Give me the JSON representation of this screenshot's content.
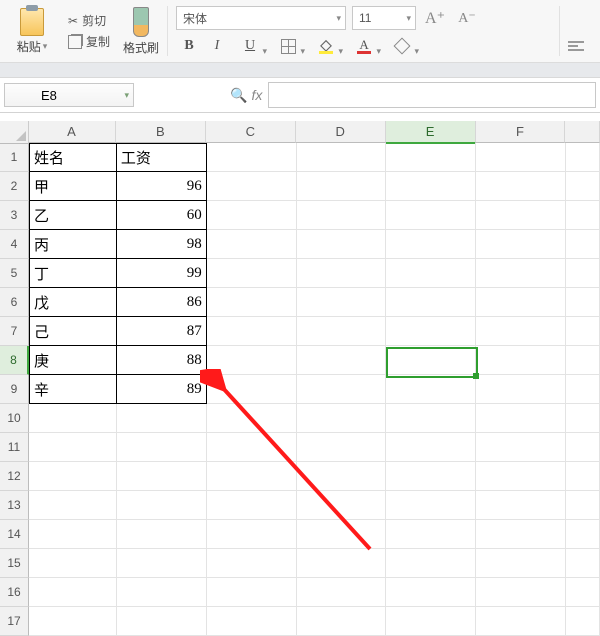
{
  "ribbon": {
    "paste_label": "粘贴",
    "cut_label": "剪切",
    "copy_label": "复制",
    "format_painter_label": "格式刷",
    "font_name": "宋体",
    "font_size": "11",
    "bold": "B",
    "italic": "I",
    "underline": "U"
  },
  "namebox": {
    "value": "E8",
    "fx_label": "fx"
  },
  "columns": [
    "A",
    "B",
    "C",
    "D",
    "E",
    "F"
  ],
  "row_numbers": [
    "1",
    "2",
    "3",
    "4",
    "5",
    "6",
    "7",
    "8",
    "9",
    "10",
    "11",
    "12",
    "13",
    "14",
    "15",
    "16",
    "17"
  ],
  "headers": {
    "name": "姓名",
    "salary": "工资"
  },
  "data_rows": [
    {
      "name": "甲",
      "salary": "96"
    },
    {
      "name": "乙",
      "salary": "60"
    },
    {
      "name": "丙",
      "salary": "98"
    },
    {
      "name": "丁",
      "salary": "99"
    },
    {
      "name": "戊",
      "salary": "86"
    },
    {
      "name": "己",
      "salary": "87"
    },
    {
      "name": "庚",
      "salary": "88"
    },
    {
      "name": "辛",
      "salary": "89"
    }
  ],
  "active_cell": "E8"
}
